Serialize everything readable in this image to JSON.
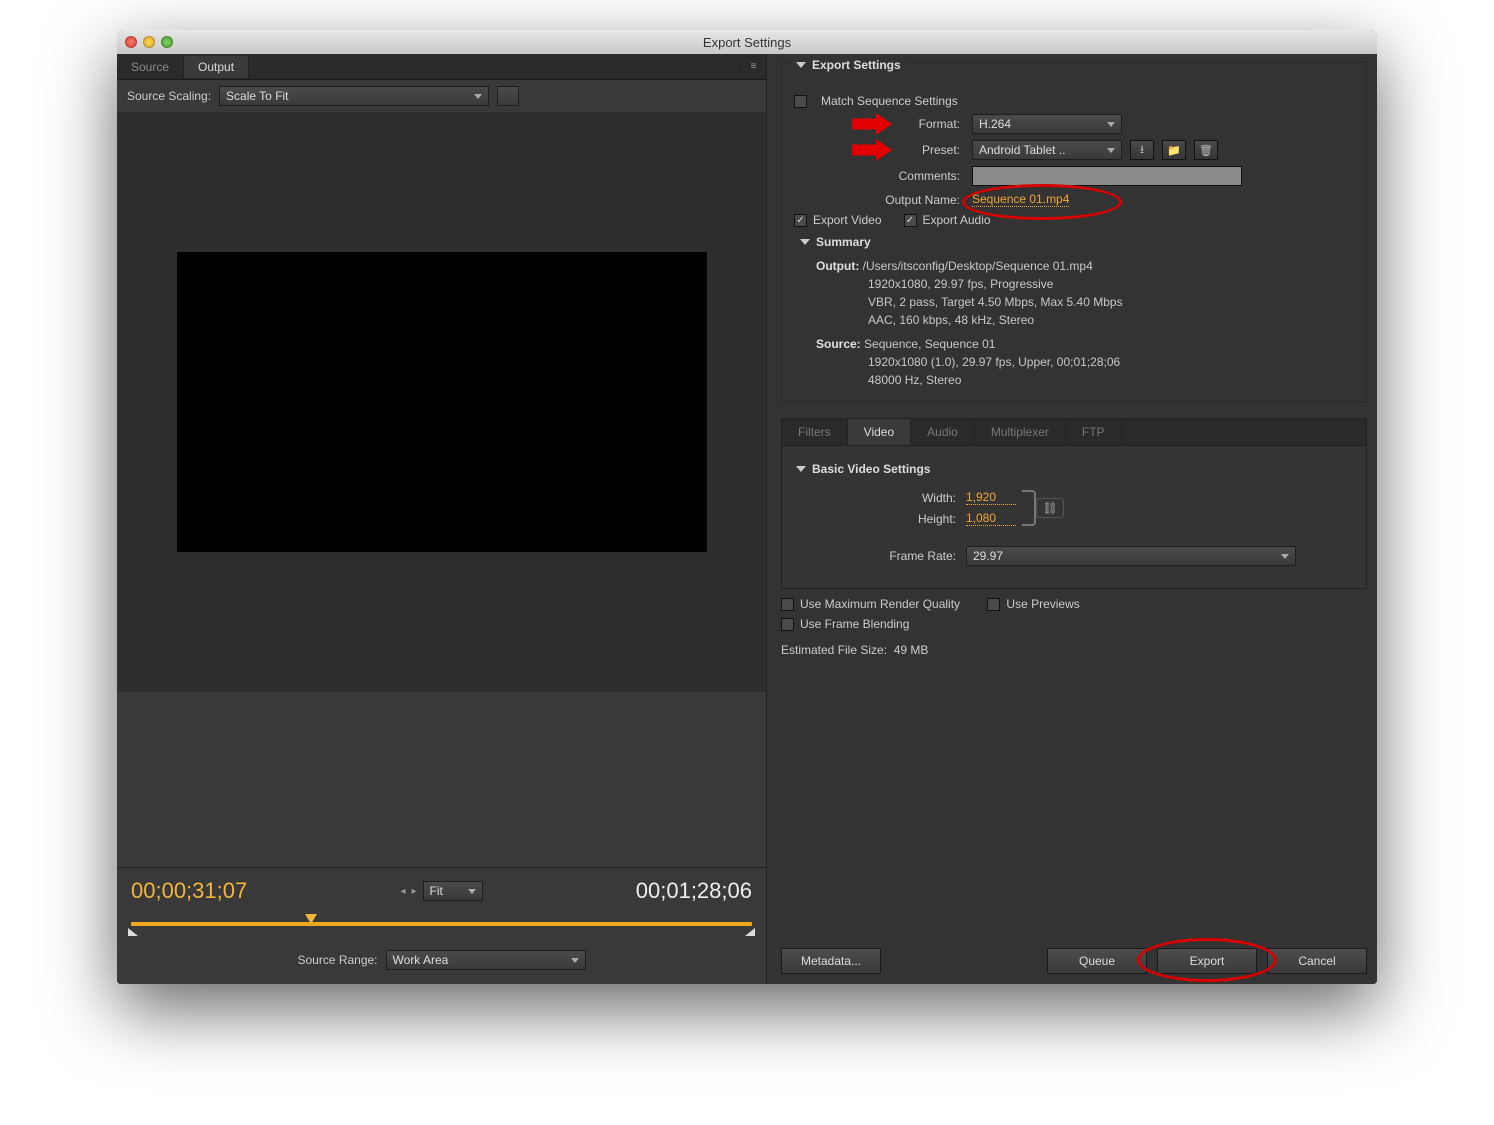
{
  "window": {
    "title": "Export Settings"
  },
  "left": {
    "tabs": {
      "source": "Source",
      "output": "Output"
    },
    "sourceScalingLabel": "Source Scaling:",
    "sourceScalingValue": "Scale To Fit",
    "timecodeIn": "00;00;31;07",
    "timecodeOut": "00;01;28;06",
    "fitLabel": "Fit",
    "sourceRangeLabel": "Source Range:",
    "sourceRangeValue": "Work Area"
  },
  "export": {
    "sectionTitle": "Export Settings",
    "matchLabel": "Match Sequence Settings",
    "formatLabel": "Format:",
    "formatValue": "H.264",
    "presetLabel": "Preset:",
    "presetValue": "Android Tablet ..",
    "commentsLabel": "Comments:",
    "outputNameLabel": "Output Name:",
    "outputNameValue": "Sequence 01.mp4",
    "exportVideoLabel": "Export Video",
    "exportAudioLabel": "Export Audio"
  },
  "summary": {
    "title": "Summary",
    "outputLabel": "Output:",
    "outputLine1": "/Users/itsconfig/Desktop/Sequence 01.mp4",
    "outputLine2": "1920x1080, 29.97 fps, Progressive",
    "outputLine3": "VBR, 2 pass, Target 4.50 Mbps, Max 5.40 Mbps",
    "outputLine4": "AAC, 160 kbps, 48 kHz, Stereo",
    "sourceLabel": "Source:",
    "sourceLine1": "Sequence, Sequence 01",
    "sourceLine2": "1920x1080 (1.0), 29.97 fps, Upper, 00;01;28;06",
    "sourceLine3": "48000 Hz, Stereo"
  },
  "tabs2": {
    "filters": "Filters",
    "video": "Video",
    "audio": "Audio",
    "multiplexer": "Multiplexer",
    "ftp": "FTP"
  },
  "basicVideo": {
    "title": "Basic Video Settings",
    "widthLabel": "Width:",
    "widthValue": "1,920",
    "heightLabel": "Height:",
    "heightValue": "1,080",
    "frameRateLabel": "Frame Rate:",
    "frameRateValue": "29.97"
  },
  "options": {
    "maxRender": "Use Maximum Render Quality",
    "usePreviews": "Use Previews",
    "frameBlending": "Use Frame Blending",
    "estLabel": "Estimated File Size:",
    "estValue": "49 MB"
  },
  "buttons": {
    "metadata": "Metadata...",
    "queue": "Queue",
    "export": "Export",
    "cancel": "Cancel"
  }
}
